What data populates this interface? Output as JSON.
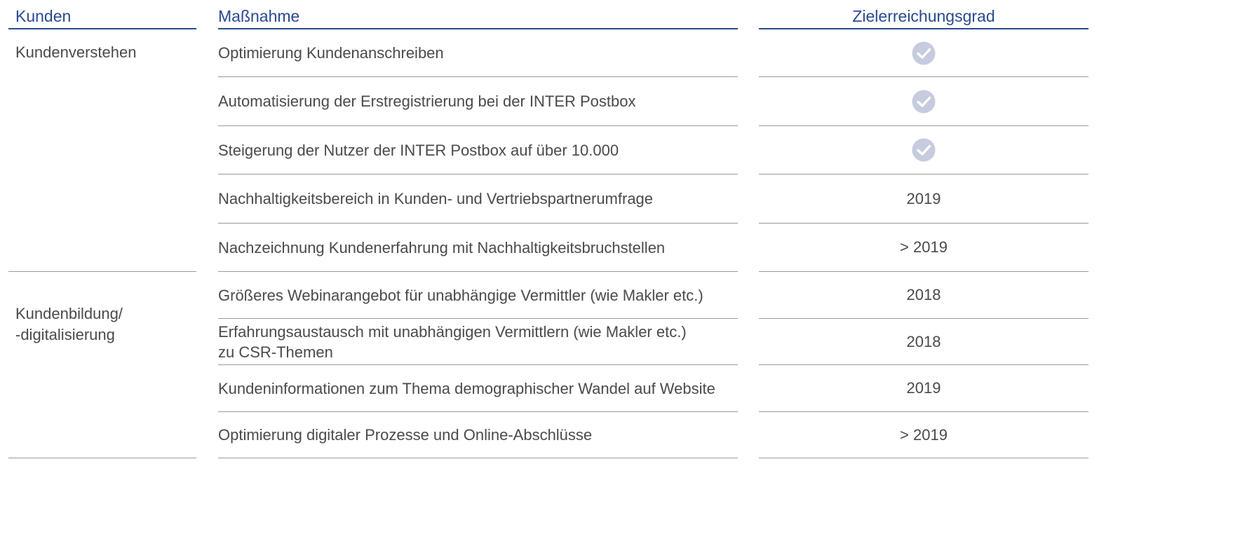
{
  "headers": {
    "kunden": "Kunden",
    "massnahme": "Maßnahme",
    "zielerreichungsgrad": "Zielerreichungsgrad"
  },
  "categories": [
    {
      "label": "Kundenverstehen"
    },
    {
      "label": "Kundenbildung/\n-digitalisierung"
    }
  ],
  "rows": [
    {
      "massnahme": "Optimierung Kundenanschreiben",
      "status": "check"
    },
    {
      "massnahme": "Automatisierung der Erstregistrierung bei der INTER Postbox",
      "status": "check"
    },
    {
      "massnahme": "Steigerung der Nutzer der INTER Postbox auf über 10.000",
      "status": "check"
    },
    {
      "massnahme": "Nachhaltigkeitsbereich in Kunden- und Vertriebspartnerumfrage",
      "status": "2019"
    },
    {
      "massnahme": "Nachzeichnung Kundenerfahrung mit Nachhaltigkeitsbruchstellen",
      "status": "> 2019"
    },
    {
      "massnahme": "Größeres Webinarangebot für unabhängige Vermittler (wie Makler etc.)",
      "status": "2018"
    },
    {
      "massnahme": "Erfahrungsaustausch mit unabhängigen Vermittlern (wie Makler etc.)\nzu CSR-Themen",
      "status": "2018"
    },
    {
      "massnahme": "Kundeninformationen zum Thema demographischer Wandel auf Website",
      "status": "2019"
    },
    {
      "massnahme": "Optimierung digitaler Prozesse und Online-Abschlüsse",
      "status": "> 2019"
    }
  ],
  "colors": {
    "header_blue": "#2a4a8e",
    "text": "#4a4a4a",
    "rule": "#9a9a9a",
    "check_circle": "#c7cbe0"
  },
  "icons": {
    "achieved": "check-circle-icon"
  }
}
